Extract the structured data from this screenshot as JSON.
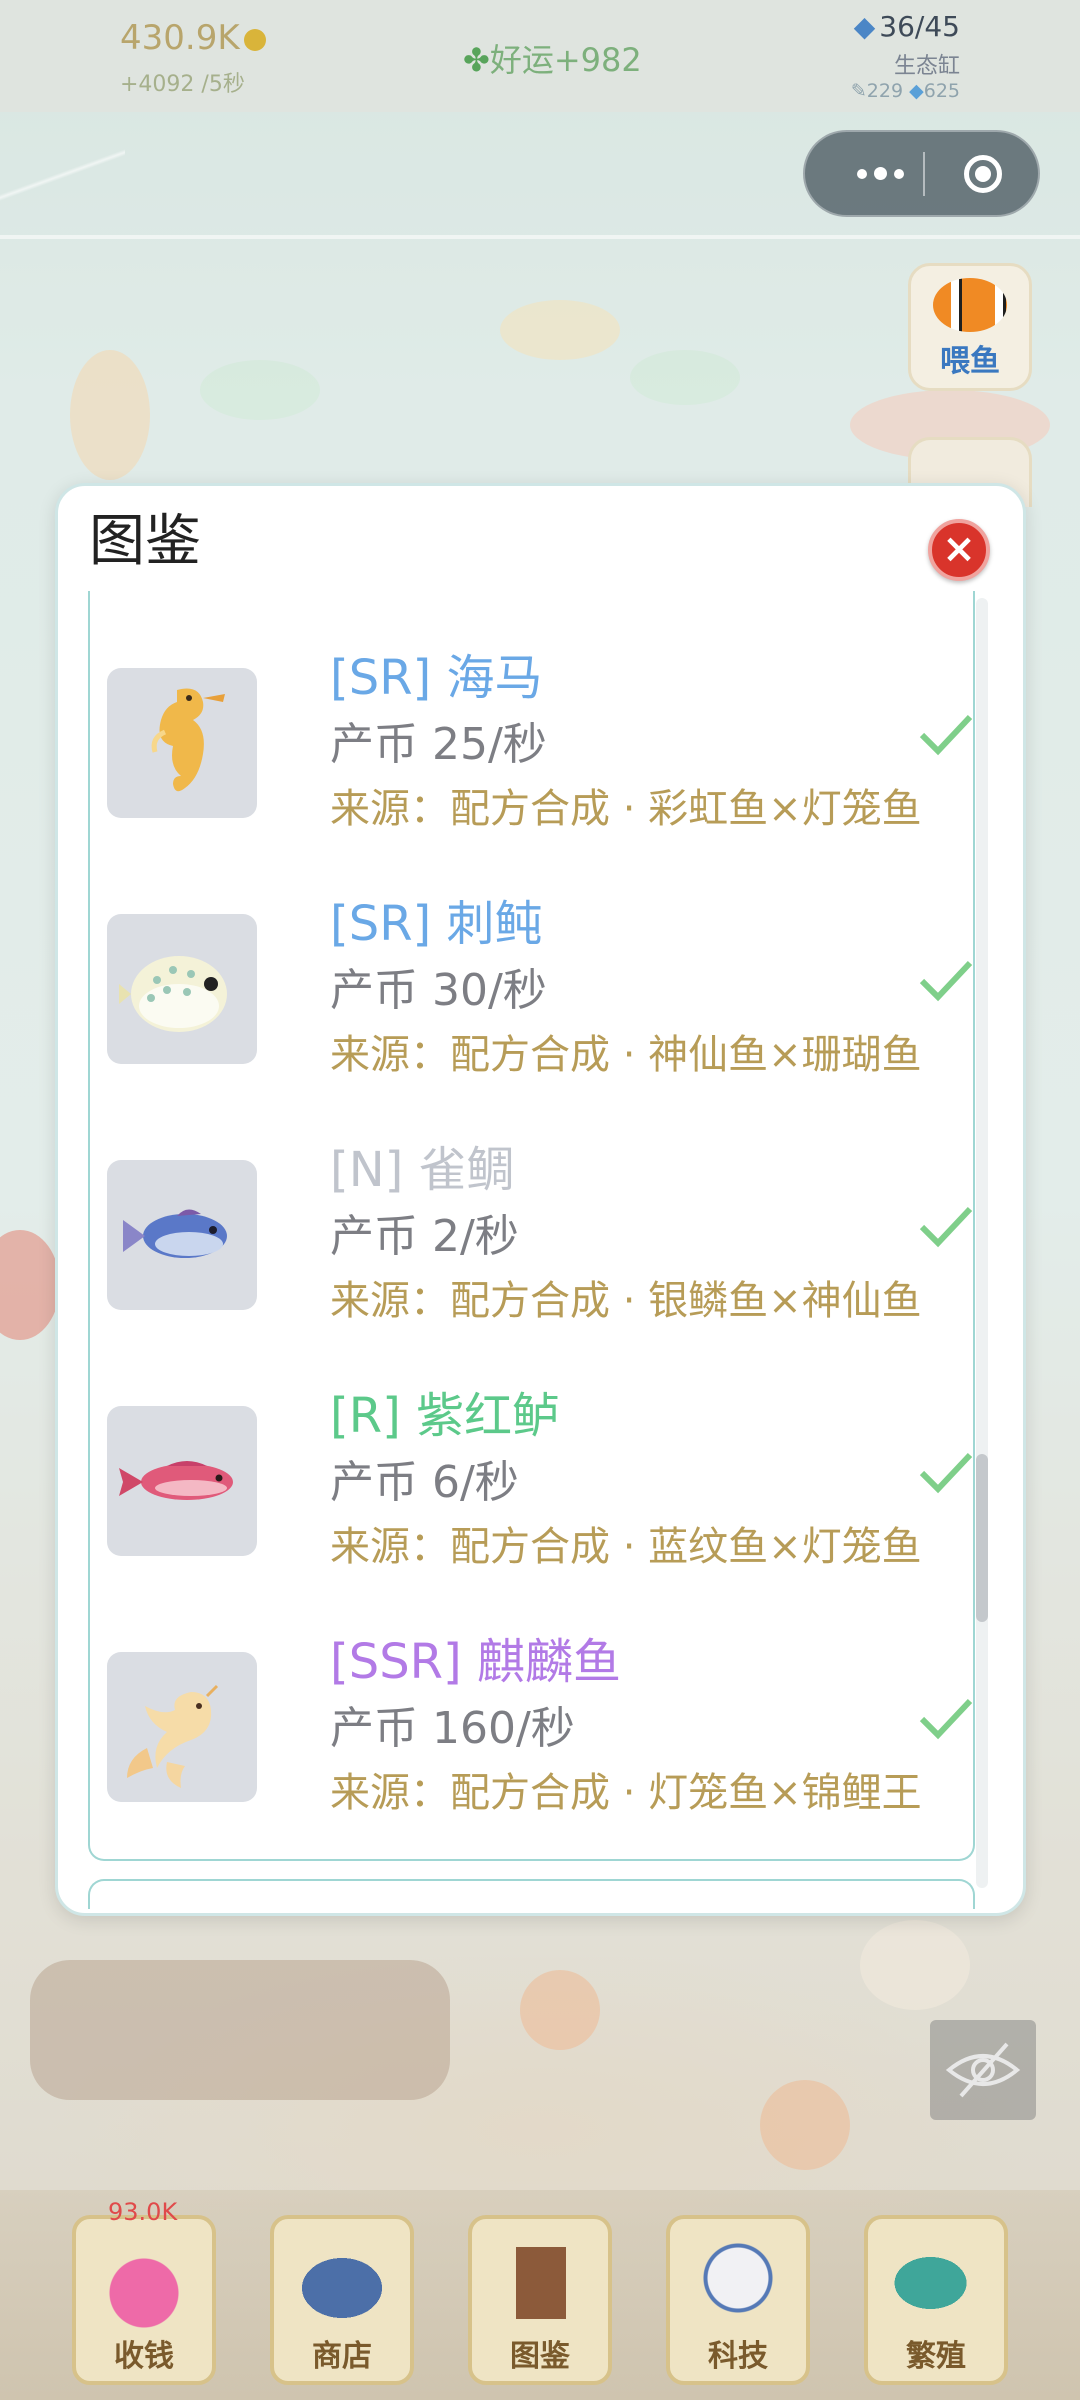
{
  "topbar": {
    "coins": "430.9K",
    "rate": "+4092 /5秒",
    "luck": "好运+982",
    "fish_count": "36/45",
    "tank_name": "生态缸",
    "stat_a": "229",
    "stat_b": "625"
  },
  "side": {
    "feed_label": "喂鱼"
  },
  "modal": {
    "title": "图鉴",
    "close_label": "×",
    "entries": [
      {
        "name": "[SR] 海马",
        "rarity": "SR",
        "rate": "产币 25/秒",
        "source": "来源：配方合成 · 彩虹鱼×灯笼鱼",
        "icon": "seahorse-icon"
      },
      {
        "name": "[SR] 刺鲀",
        "rarity": "SR",
        "rate": "产币 30/秒",
        "source": "来源：配方合成 · 神仙鱼×珊瑚鱼",
        "icon": "pufferfish-icon"
      },
      {
        "name": "[N] 雀鲷",
        "rarity": "N",
        "rate": "产币 2/秒",
        "source": "来源：配方合成 · 银鳞鱼×神仙鱼",
        "icon": "damselfish-icon"
      },
      {
        "name": "[R] 紫红鲈",
        "rarity": "R",
        "rate": "产币 6/秒",
        "source": "来源：配方合成 · 蓝纹鱼×灯笼鱼",
        "icon": "perch-icon"
      },
      {
        "name": "[SSR] 麒麟鱼",
        "rarity": "SSR",
        "rate": "产币 160/秒",
        "source": "来源：配方合成 · 灯笼鱼×锦鲤王",
        "icon": "qilin-fish-icon"
      }
    ]
  },
  "rarity_colors": {
    "SR": "#6aa8e6",
    "N": "#c0c4cc",
    "R": "#5cc98a",
    "SSR": "#b27ae6"
  },
  "bottom_nav": {
    "collect_amount": "93.0K",
    "items": [
      "收钱",
      "商店",
      "图鉴",
      "科技",
      "繁殖"
    ]
  }
}
